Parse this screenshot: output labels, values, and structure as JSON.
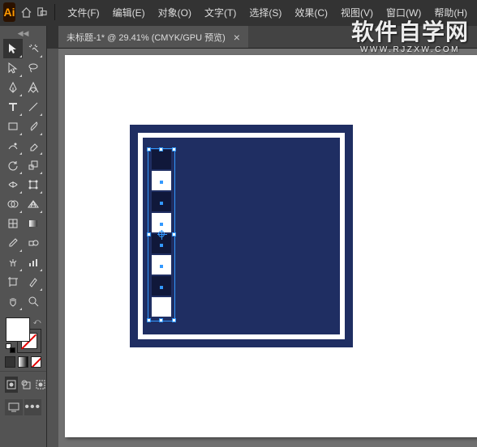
{
  "app": {
    "logo_text": "Ai"
  },
  "menu": [
    "文件(F)",
    "编辑(E)",
    "对象(O)",
    "文字(T)",
    "选择(S)",
    "效果(C)",
    "视图(V)",
    "窗口(W)",
    "帮助(H)"
  ],
  "document": {
    "tab_label": "未标题-1* @ 29.41% (CMYK/GPU 预览)",
    "close_glyph": "×"
  },
  "watermark": {
    "main": "软件自学网",
    "sub": "WWW.RJZXW.COM"
  },
  "colors": {
    "artwork_navy": "#1f2e62",
    "artwork_dark": "#10183a",
    "selection_blue": "#3399ff"
  }
}
